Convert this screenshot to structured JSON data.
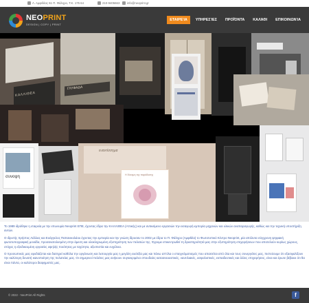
{
  "topbar": {
    "address": "Λ. Αμφιθέας 61 Π. Φάληρο, Τ.Κ. 175 64",
    "phone": "210-9405663",
    "email": "info@neoprint.gr"
  },
  "brand": {
    "name_main": "NEO",
    "name_accent": "PRINT",
    "tagline": "DESIGN | COPY | PRINT"
  },
  "nav": {
    "items": [
      {
        "label": "Εταιρεία",
        "active": true
      },
      {
        "label": "Υπηρεσίες",
        "active": false
      },
      {
        "label": "Προϊόντα",
        "active": false
      },
      {
        "label": "Καλάθι",
        "active": false
      },
      {
        "label": "Επικοινωνία",
        "active": false
      }
    ]
  },
  "hero": {
    "sign_text_1": "ΚΑΛΛΙΘΕΑ",
    "sign_text_2": "ΓΛΥΦΑΔΑ",
    "card_title": "εναντίσσημα",
    "card_caption": "Η δύναμη της παράδοσης",
    "book_title": "συνοψη"
  },
  "content": {
    "paragraph_1": "Το 1989 ιδρύθηκε η εταιρεία με την επωνυμία Neoprint ΕΠΕ, έχοντας έδρα την ΚΑΛΛΙΘΕΑ (Αττικής) και με αντικείμενο εργασιών την εισαγωγή-εμπορία μηχανών και υλικών αναπαραγωγής, καθώς και την τεχνική υποστήριξη αυτών.",
    "paragraph_2": "Ο ιδρυτής Χρήστος Λάλλας και Ευάγγελος Παπανικολάου έχοντας την εμπειρία και την γνώση ίδρυσαν το 2002 με έδρα το Π. Φάληρο (Αμφιθέα) το Φωτοτυπικό Κέντρο Neoprint, μία απόλυτα σύγχρονη ψηφιακή φωτοτυπογραφική μονάδα, προσανατολισμένη στην άμεση και ολοκληρωμένη εξυπηρέτηση των πελατών της. Έχουμε επικεντρωθεί τη δραστηριότητά μας στην εξυπηρέτηση επιχειρήσεων που αποτελούν κυρίως χώρους, στόχος η εξειδικευμένη εργασίες υψηλής ποιότητας με ταχύτητα, αξιοπιστία και ευχέλεια.",
    "paragraph_3": "Ο προσωπικός μας εφοδιάζεται και διατηρεί καθόλα την οργάνωση και λειτουργία μας η μεγάλη ευελιξία μας και πάνω απ'όλα ο επαγγελματισμός που απαιτείται από όλα και τους συνεργάτες μας, πιστεύουμε ότι εξασφαλίζουν την καλύτερη δυνατή ικανοποίηση της πελατείας μας. Οι σημερινοί πελάτες μας ανήκουν συγκεκριμένα σπουδαίες κατασκευαστικές, ναυτιλιακές, ασφαλιστικές, εκπαιδευτικές και άλλες επιχειρήσεις, είναι και έρωτε βέβαιοι ότι θα είναι πάντα, οι καλύτεροι διαφημιστές μας."
  },
  "footer": {
    "copyright": "© 2022 - NeoPrint All Rights",
    "social_icon": "facebook-icon",
    "social_glyph": "f"
  },
  "colors": {
    "header_bg": "#3a3a3a",
    "accent": "#f08a1d",
    "body_text": "#3f5fa8",
    "facebook": "#3b5a9a"
  }
}
